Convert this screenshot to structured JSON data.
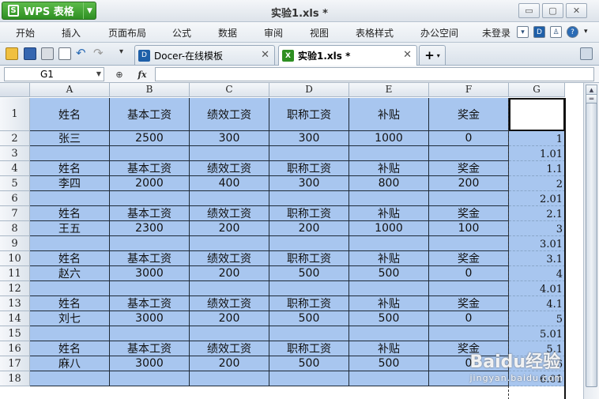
{
  "titlebar": {
    "app_label": "WPS 表格",
    "logo_glyph": "S",
    "doc_title": "实验1.xls *",
    "min_glyph": "▭",
    "restore_glyph": "▢",
    "close_glyph": "✕"
  },
  "menu": {
    "items": [
      "开始",
      "插入",
      "页面布局",
      "公式",
      "数据",
      "审阅",
      "视图",
      "表格样式",
      "办公空间"
    ],
    "login": "未登录",
    "help_glyph": "?"
  },
  "tabs": [
    {
      "label": "Docer-在线模板",
      "icon_glyph": "D",
      "icon_color": "#1e5fa8"
    },
    {
      "label": "实验1.xls *",
      "icon_glyph": "X",
      "icon_color": "#2e8f22"
    }
  ],
  "tab_add": "+",
  "formula": {
    "cell_ref": "G1",
    "fx_label": "fx",
    "zoom_glyph": "⊕",
    "value": ""
  },
  "columns": [
    "A",
    "B",
    "C",
    "D",
    "E",
    "F",
    "G"
  ],
  "rows": [
    {
      "num": "1",
      "cells": [
        "姓名",
        "基本工资",
        "绩效工资",
        "职称工资",
        "补贴",
        "奖金"
      ],
      "g": ""
    },
    {
      "num": "2",
      "cells": [
        "张三",
        "2500",
        "300",
        "300",
        "1000",
        "0"
      ],
      "g": "1"
    },
    {
      "num": "3",
      "cells": [
        "",
        "",
        "",
        "",
        "",
        ""
      ],
      "g": "1.01"
    },
    {
      "num": "4",
      "cells": [
        "姓名",
        "基本工资",
        "绩效工资",
        "职称工资",
        "补贴",
        "奖金"
      ],
      "g": "1.1"
    },
    {
      "num": "5",
      "cells": [
        "李四",
        "2000",
        "400",
        "300",
        "800",
        "200"
      ],
      "g": "2"
    },
    {
      "num": "6",
      "cells": [
        "",
        "",
        "",
        "",
        "",
        ""
      ],
      "g": "2.01"
    },
    {
      "num": "7",
      "cells": [
        "姓名",
        "基本工资",
        "绩效工资",
        "职称工资",
        "补贴",
        "奖金"
      ],
      "g": "2.1"
    },
    {
      "num": "8",
      "cells": [
        "王五",
        "2300",
        "200",
        "200",
        "1000",
        "100"
      ],
      "g": "3"
    },
    {
      "num": "9",
      "cells": [
        "",
        "",
        "",
        "",
        "",
        ""
      ],
      "g": "3.01"
    },
    {
      "num": "10",
      "cells": [
        "姓名",
        "基本工资",
        "绩效工资",
        "职称工资",
        "补贴",
        "奖金"
      ],
      "g": "3.1"
    },
    {
      "num": "11",
      "cells": [
        "赵六",
        "3000",
        "200",
        "500",
        "500",
        "0"
      ],
      "g": "4"
    },
    {
      "num": "12",
      "cells": [
        "",
        "",
        "",
        "",
        "",
        ""
      ],
      "g": "4.01"
    },
    {
      "num": "13",
      "cells": [
        "姓名",
        "基本工资",
        "绩效工资",
        "职称工资",
        "补贴",
        "奖金"
      ],
      "g": "4.1"
    },
    {
      "num": "14",
      "cells": [
        "刘七",
        "3000",
        "200",
        "500",
        "500",
        "0"
      ],
      "g": "5"
    },
    {
      "num": "15",
      "cells": [
        "",
        "",
        "",
        "",
        "",
        ""
      ],
      "g": "5.01"
    },
    {
      "num": "16",
      "cells": [
        "姓名",
        "基本工资",
        "绩效工资",
        "职称工资",
        "补贴",
        "奖金"
      ],
      "g": "5.1"
    },
    {
      "num": "17",
      "cells": [
        "麻八",
        "3000",
        "200",
        "500",
        "500",
        "0"
      ],
      "g": "6"
    },
    {
      "num": "18",
      "cells": [
        "",
        "",
        "",
        "",
        "",
        ""
      ],
      "g": "6.01"
    }
  ],
  "watermark": {
    "brand": "Baidu经验",
    "url": "jingyan.baidu.com"
  },
  "colors": {
    "selection": "#a8c6ef",
    "wps_green": "#2e8f22"
  }
}
